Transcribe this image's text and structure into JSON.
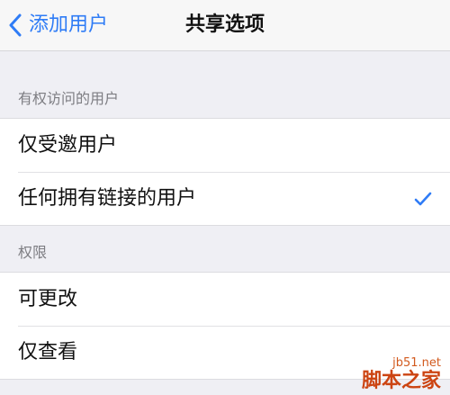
{
  "navbar": {
    "back_label": "添加用户",
    "title": "共享选项"
  },
  "access_section": {
    "header": "有权访问的用户",
    "options": [
      {
        "label": "仅受邀用户",
        "selected": false
      },
      {
        "label": "任何拥有链接的用户",
        "selected": true
      }
    ]
  },
  "permission_section": {
    "header": "权限",
    "options": [
      {
        "label": "可更改"
      },
      {
        "label": "仅查看"
      }
    ]
  },
  "watermark": {
    "url": "jb51.net",
    "name": "脚本之家"
  },
  "colors": {
    "accent": "#2f7cf6",
    "background": "#efeff4"
  },
  "icons": {
    "back": "chevron-left-icon",
    "selected": "checkmark-icon"
  }
}
